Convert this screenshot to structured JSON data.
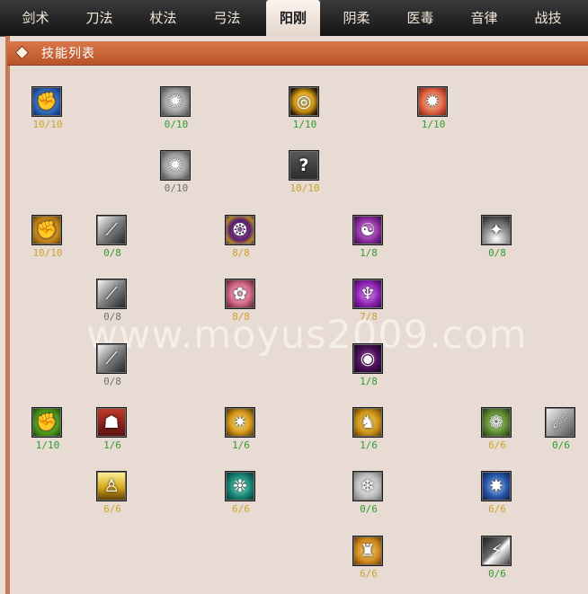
{
  "tabs": [
    {
      "label": "剑术",
      "active": false
    },
    {
      "label": "刀法",
      "active": false
    },
    {
      "label": "杖法",
      "active": false
    },
    {
      "label": "弓法",
      "active": false
    },
    {
      "label": "阳刚",
      "active": true
    },
    {
      "label": "阴柔",
      "active": false
    },
    {
      "label": "医毒",
      "active": false
    },
    {
      "label": "音律",
      "active": false
    },
    {
      "label": "战技",
      "active": false
    }
  ],
  "section": {
    "title": "技能列表"
  },
  "watermark": "www.moyus2009.com",
  "skills": [
    {
      "icon": "fist-icon",
      "level": "10/10",
      "color": "gold"
    },
    {
      "icon": "silver-orb-icon",
      "level": "0/10",
      "color": "green"
    },
    {
      "icon": "golden-ring-icon",
      "level": "1/10",
      "color": "green"
    },
    {
      "icon": "flame-burst-icon",
      "level": "1/10",
      "color": "green"
    },
    {
      "icon": "silver-orb-icon",
      "level": "0/10",
      "color": "gray"
    },
    {
      "icon": "question-mark-icon",
      "level": "10/10",
      "color": "gold"
    },
    {
      "icon": "golden-fist-icon",
      "level": "10/10",
      "color": "gold"
    },
    {
      "icon": "light-rays-icon",
      "level": "0/8",
      "color": "green"
    },
    {
      "icon": "violet-seal-icon",
      "level": "8/8",
      "color": "gold"
    },
    {
      "icon": "purple-swirl-icon",
      "level": "1/8",
      "color": "green"
    },
    {
      "icon": "white-burst-icon",
      "level": "0/8",
      "color": "green"
    },
    {
      "icon": "light-rays-icon",
      "level": "0/8",
      "color": "gray"
    },
    {
      "icon": "pink-spark-icon",
      "level": "8/8",
      "color": "gold"
    },
    {
      "icon": "purple-figure-icon",
      "level": "7/8",
      "color": "gold"
    },
    {
      "icon": "light-rays-icon",
      "level": "0/8",
      "color": "gray"
    },
    {
      "icon": "dark-vortex-icon",
      "level": "1/8",
      "color": "green"
    },
    {
      "icon": "green-fist-icon",
      "level": "1/10",
      "color": "green"
    },
    {
      "icon": "warrior-icon",
      "level": "1/6",
      "color": "green"
    },
    {
      "icon": "golden-spark-icon",
      "level": "1/6",
      "color": "green"
    },
    {
      "icon": "tiger-icon",
      "level": "1/6",
      "color": "green"
    },
    {
      "icon": "green-wheel-icon",
      "level": "6/6",
      "color": "gold"
    },
    {
      "icon": "silver-claw-icon",
      "level": "0/6",
      "color": "green"
    },
    {
      "icon": "warrior-aura-icon",
      "level": "6/6",
      "color": "gold"
    },
    {
      "icon": "teal-aura-icon",
      "level": "6/6",
      "color": "gold"
    },
    {
      "icon": "white-mist-icon",
      "level": "0/6",
      "color": "green"
    },
    {
      "icon": "blue-burst-icon",
      "level": "6/6",
      "color": "gold"
    },
    {
      "icon": "golden-beast-icon",
      "level": "6/6",
      "color": "gold"
    },
    {
      "icon": "white-slash-icon",
      "level": "0/6",
      "color": "green"
    }
  ],
  "colors": {
    "level_gold": "#c9a32a",
    "level_green": "#2e9d2e",
    "level_gray": "#6f6f6f",
    "header_orange": "#c9663a",
    "tab_bar": "#1f1f1f"
  }
}
